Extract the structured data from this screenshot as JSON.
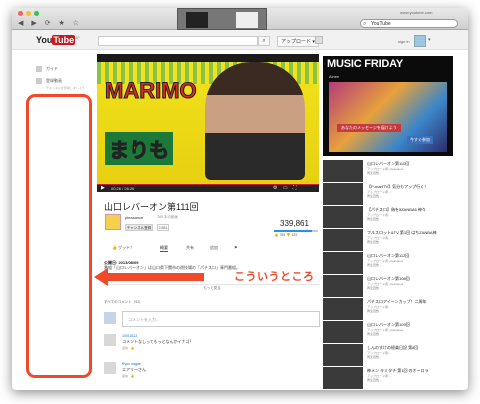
{
  "browser": {
    "url_small": "www.youtube.com",
    "search_text": "YouTube",
    "nav_glyphs": "◀ ▶ ⟳ ★ ☆"
  },
  "youtube": {
    "logo_you": "You",
    "logo_tube": "Tube",
    "logo_region": "JP",
    "search_icon": "search-icon",
    "upload_label": "アップロード ▾",
    "signin_text": "sign in"
  },
  "guide": {
    "items": [
      "ガイド",
      "登録動画"
    ],
    "sub_text": "チャンネルを登録しましょう"
  },
  "video": {
    "overlay_main": "MARIMO",
    "overlay_jp": "まりも",
    "time": "00:26 / 26:26",
    "title": "山口レバーオン第111回",
    "channel": "pleasance",
    "channel_videos": "· 285 本の動画",
    "subscribe_label": "チャンネル登録",
    "subscriber_count": "2,851",
    "views": "339,861",
    "like_fraction": 0.86,
    "likes": "👍 785   👎 125",
    "like_label": "👍 グッド！",
    "tabs": [
      "概要",
      "共有",
      "追加",
      "⚑"
    ],
    "published": "公開日: 2013/08/09",
    "description": "番組「山口レバーオン」は山口県下関市の遊技場の「パチスロ」専門番組。",
    "more_label": "もっと見る"
  },
  "annotation": {
    "text": "こういうところ",
    "color": "#f04a2a"
  },
  "comments": {
    "header": "すべてのコメント（93）",
    "placeholder": "コメントを入力...",
    "items": [
      {
        "author": "10010112",
        "text": "コメントなしってもっとなんかイナゴ？",
        "footer": "返信 · 👍"
      },
      {
        "author": "Ryou nagae",
        "text": "エアリーさん",
        "footer": "返信 · 👍"
      }
    ]
  },
  "sidebar": {
    "ad_title": "MUSIC FRIDAY",
    "ad_sub": "Ainee",
    "ad_btn1": "あなたのメッセージを届けよう",
    "ad_btn2": "今すぐ参加",
    "related": [
      {
        "title": "山口レバーオン第110回",
        "channel": "アップロード者: pleasance",
        "views": "再生回数 ..."
      },
      {
        "title": "【P-martTV】気分もアップ行く！",
        "channel": "アップロード者: ...",
        "views": "再生回数 ..."
      },
      {
        "title": "【パチスロ】偽を5ZANBA6 神々",
        "channel": "アップロード者: ...",
        "views": "再生回数 ..."
      },
      {
        "title": "フルスロット&TV 第1回 はちZANBA神",
        "channel": "アップロード者: ...",
        "views": "再生回数 ..."
      },
      {
        "title": "山口レバーオン第112回",
        "channel": "アップロード者: pleasance",
        "views": "再生回数 ..."
      },
      {
        "title": "山口レバーオン第108回",
        "channel": "アップロード者: pleasance",
        "views": "再生回数 ..."
      },
      {
        "title": "パチスロアイーンカップ！二周年",
        "channel": "アップロード者: ...",
        "views": "再生回数 ..."
      },
      {
        "title": "山口レバーオン第109回",
        "channel": "アップロード者: pleasance",
        "views": "再生回数 ..."
      },
      {
        "title": "しんのすけの極楽日記 第8回",
        "channel": "アップロード者: ...",
        "views": "再生回数 ..."
      },
      {
        "title": "神メン キミタチ 第1回 のオーロラ",
        "channel": "アップロード者: ...",
        "views": "再生回数 ..."
      }
    ]
  }
}
